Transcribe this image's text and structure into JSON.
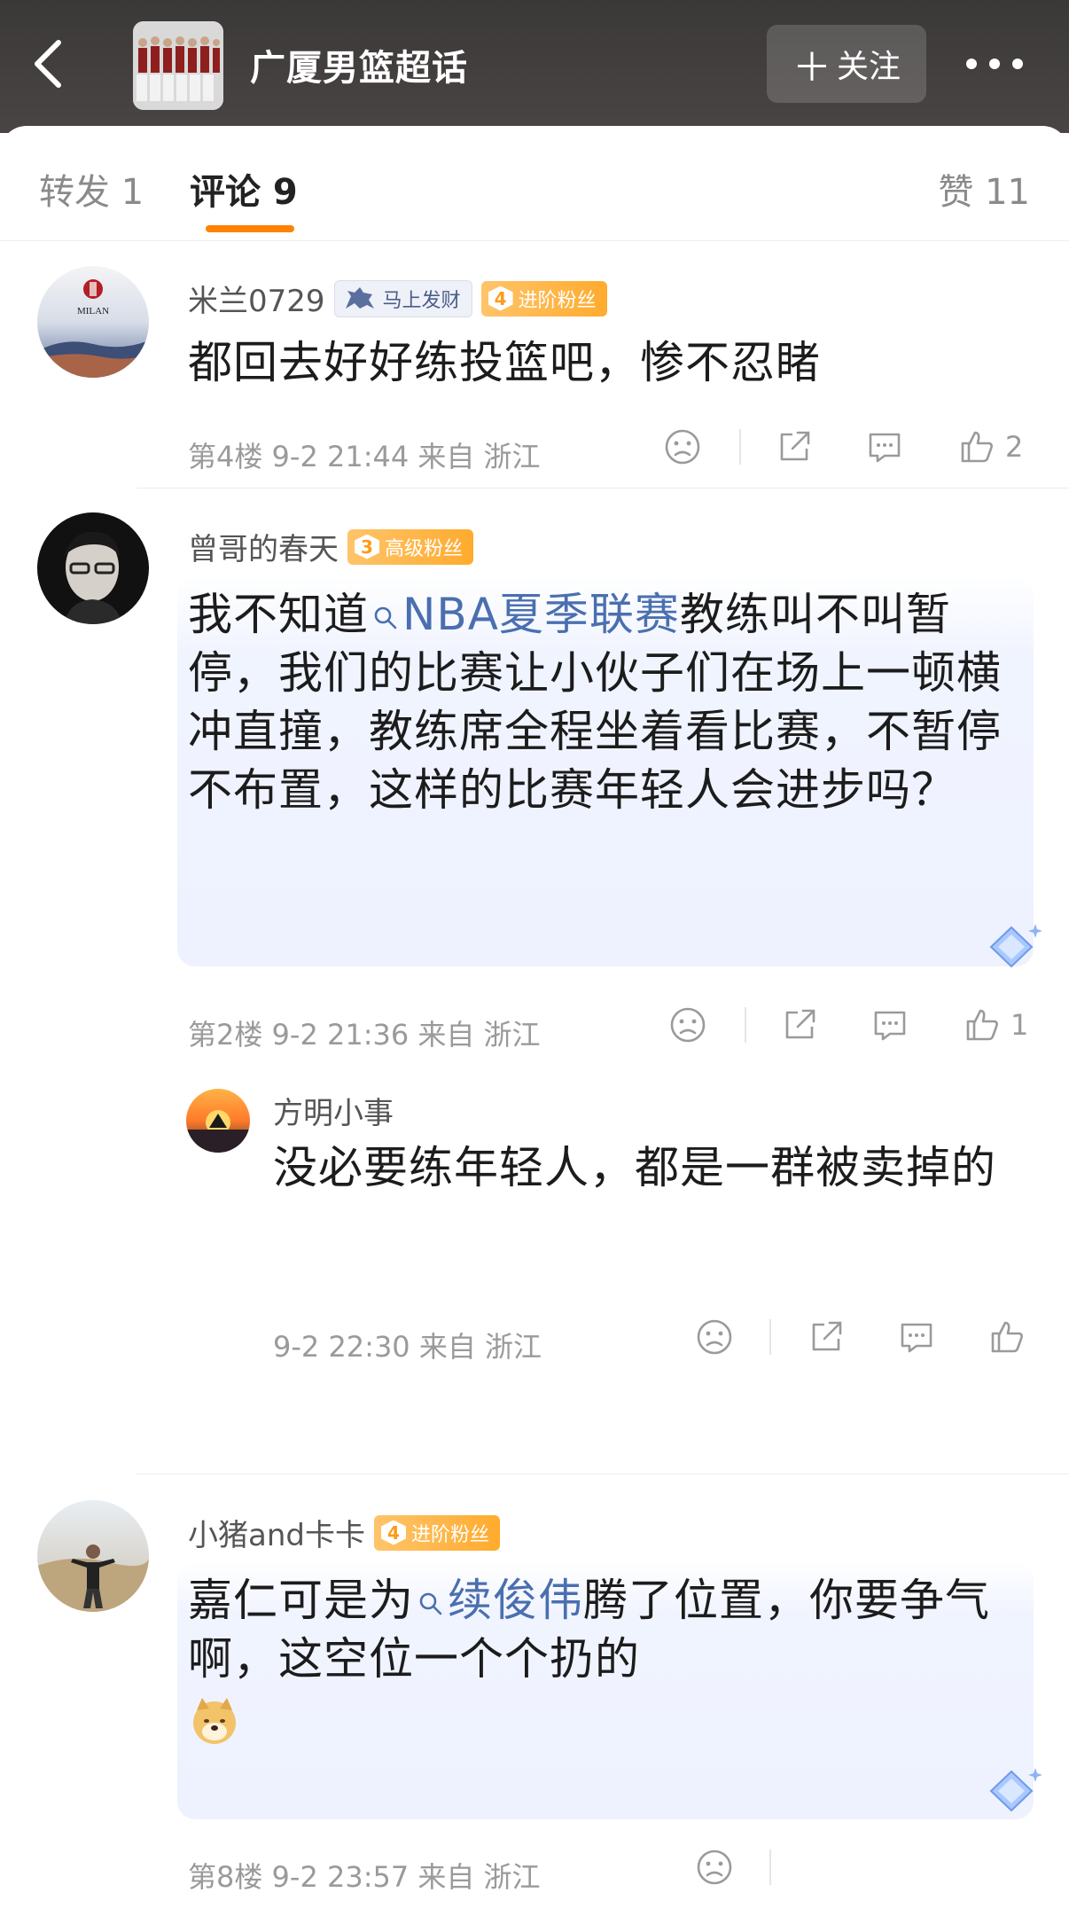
{
  "header": {
    "title": "广厦男篮超话",
    "follow_label": "关注",
    "back_icon": "back-arrow-icon",
    "more_icon": "more-dots-icon"
  },
  "tabs": {
    "repost": "转发 1",
    "comments": "评论 9",
    "likes": "赞 11",
    "active_color": "#ff8200"
  },
  "comments": [
    {
      "username": "米兰0729",
      "medal": "马上发财",
      "fan_level": "4",
      "fan_badge": "进阶粉丝",
      "text": "都回去好好练投篮吧，惨不忍睹",
      "meta": "第4楼  9-2 21:44  来自 浙江",
      "likes": "2"
    },
    {
      "username": "曾哥的春天",
      "fan_level": "3",
      "fan_badge": "高级粉丝",
      "text_before": "我不知道",
      "topic": "NBA夏季联赛",
      "text_after": "教练叫不叫暂停，我们的比赛让小伙子们在场上一顿横冲直撞，教练席全程坐着看比赛，不暂停不布置，这样的比赛年轻人会进步吗？",
      "meta": "第2楼  9-2 21:36  来自 浙江",
      "likes": "1",
      "reply": {
        "username": "方明小事",
        "text": "没必要练年轻人，都是一群被卖掉的",
        "meta": "9-2 22:30  来自 浙江"
      }
    },
    {
      "username": "小猪and卡卡",
      "fan_level": "4",
      "fan_badge": "进阶粉丝",
      "text_before": "嘉仁可是为",
      "topic": "续俊伟",
      "text_after": "腾了位置，你要争气啊，这空位一个个扔的",
      "meta": "第8楼  9-2 23:57  来自 浙江"
    }
  ]
}
